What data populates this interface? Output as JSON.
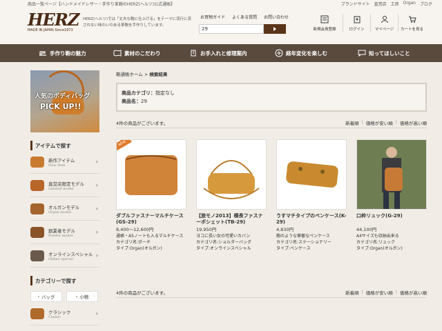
{
  "top": {
    "breadcrumb": "商品一覧ページ【ハンドメイドレザー・手作り革鞄のHERZ(ヘルツ)公式通販】",
    "links": [
      "ブランドサイト",
      "直営店",
      "工房",
      "Organ",
      "ブログ"
    ]
  },
  "header": {
    "logo": "HERZ",
    "logo_sub": "MADE IN JAPAN Since1973",
    "tagline": "HERZ(ヘルツ)では「丈夫な鞄に仕上げる」をテーマに流行に流されない味わいのある革鞄を手作りしています。",
    "guide_links": [
      "お買物ガイド",
      "よくある質問",
      "お問い合わせ"
    ],
    "search_value": "29",
    "nav_icons": [
      {
        "label": "新規会員登録",
        "icon": "register-icon"
      },
      {
        "label": "ログイン",
        "icon": "login-icon"
      },
      {
        "label": "マイページ",
        "icon": "mypage-icon"
      },
      {
        "label": "カートを見る",
        "icon": "cart-icon"
      }
    ]
  },
  "gnav": [
    {
      "label": "手作り鞄の魅力",
      "icon": "sewing-machine-icon"
    },
    {
      "label": "素材のこだわり",
      "icon": "leather-icon"
    },
    {
      "label": "お手入れと修理案内",
      "icon": "care-icon"
    },
    {
      "label": "経年変化を楽しむ",
      "icon": "plus-circle-icon"
    },
    {
      "label": "知ってほしいこと",
      "icon": "speech-icon"
    }
  ],
  "sidebar": {
    "banner_line1": "人気のボディバッグ",
    "banner_line2": "PICK UP!!",
    "item_section": "アイテムで探す",
    "items": [
      {
        "label": "新作アイテム",
        "sub": "New item",
        "color": "#c97a2f"
      },
      {
        "label": "直営店限定モデル",
        "sub": "Limited model",
        "color": "#b8662a"
      },
      {
        "label": "オルガンモデル",
        "sub": "Organ model",
        "color": "#a5642d"
      },
      {
        "label": "創業者モデル",
        "sub": "Ponder model",
        "color": "#8a5428"
      },
      {
        "label": "オンラインスペシャル",
        "sub": "Online special",
        "color": "#6b5a4c"
      }
    ],
    "category_section": "カテゴリーで探す",
    "tabs": [
      "バッグ",
      "小物"
    ],
    "classic": {
      "label": "クラシック",
      "sub": "Classic",
      "color": "#b06a2b"
    }
  },
  "main": {
    "crumb_home": "鞄通販ホーム",
    "crumb_sep": ">",
    "crumb_current": "検索結果",
    "cond": {
      "category_label": "商品カテゴリ：",
      "category_value": "指定なし",
      "name_label": "商品名：",
      "name_value": "29"
    },
    "count_text": "4件の商品がございます。",
    "sorts": [
      "新着順",
      "価格が安い順",
      "価格が高い順"
    ],
    "new_badge": "NEW",
    "products": [
      {
        "name": "ダブルファスナーマルチケース(GS-29)",
        "price": "8,400～12,600円",
        "desc": [
          "通帳・A5ノートも入るマルチケース",
          "カテゴリ名:ポーチ",
          "タイプ:Organ(オルガン)"
        ],
        "color": "#d0843a"
      },
      {
        "name": "【旅モノ2013】横長ファスナーポシェット(TB-29)",
        "price": "19,950円",
        "desc": [
          "ヨコに長い女の可愛いカバン",
          "カテゴリ名:ショルダーバッグ",
          "タイプ:オンラインスペシャル"
        ],
        "color": "#d69a3d"
      },
      {
        "name": "うすマチタイプのペンケース(K-29)",
        "price": "4,830円",
        "desc": [
          "鞄のような華奢なペンケース",
          "カテゴリ名:ステーショナリー",
          "タイプ:ペンケース"
        ],
        "color": "#c98a2f"
      },
      {
        "name": "口枠リュック(G-29)",
        "price": "44,100円",
        "desc": [
          "A4サイズも収納出来る",
          "カテゴリ名:リュック",
          "タイプ:Organ(オルガン)"
        ],
        "color": "#c67a35"
      }
    ]
  }
}
